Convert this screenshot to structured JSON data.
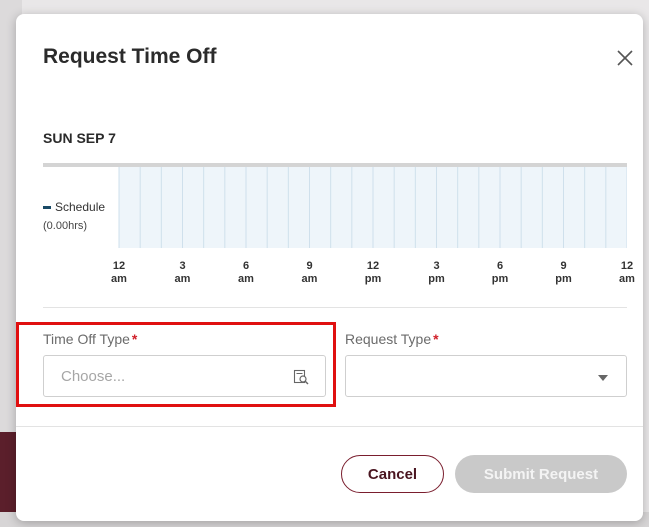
{
  "modal": {
    "title": "Request Time Off",
    "date": "SUN SEP 7"
  },
  "schedule": {
    "label": "Schedule",
    "hours": "(0.00hrs)"
  },
  "timeline": {
    "ticks": [
      {
        "num": "12",
        "period": "am"
      },
      {
        "num": "3",
        "period": "am"
      },
      {
        "num": "6",
        "period": "am"
      },
      {
        "num": "9",
        "period": "am"
      },
      {
        "num": "12",
        "period": "pm"
      },
      {
        "num": "3",
        "period": "pm"
      },
      {
        "num": "6",
        "period": "pm"
      },
      {
        "num": "9",
        "period": "pm"
      },
      {
        "num": "12",
        "period": "am"
      }
    ]
  },
  "form": {
    "time_off_type": {
      "label": "Time Off Type",
      "required_mark": "*",
      "placeholder": "Choose...",
      "icon": "lookup-icon"
    },
    "request_type": {
      "label": "Request Type",
      "required_mark": "*",
      "value": "",
      "icon": "chevron-down-icon"
    }
  },
  "buttons": {
    "cancel": "Cancel",
    "submit": "Submit Request"
  },
  "colors": {
    "accent": "#7a1e2e",
    "highlight": "#e01010",
    "required": "#d0202a",
    "disabled": "#c9c9c9"
  }
}
